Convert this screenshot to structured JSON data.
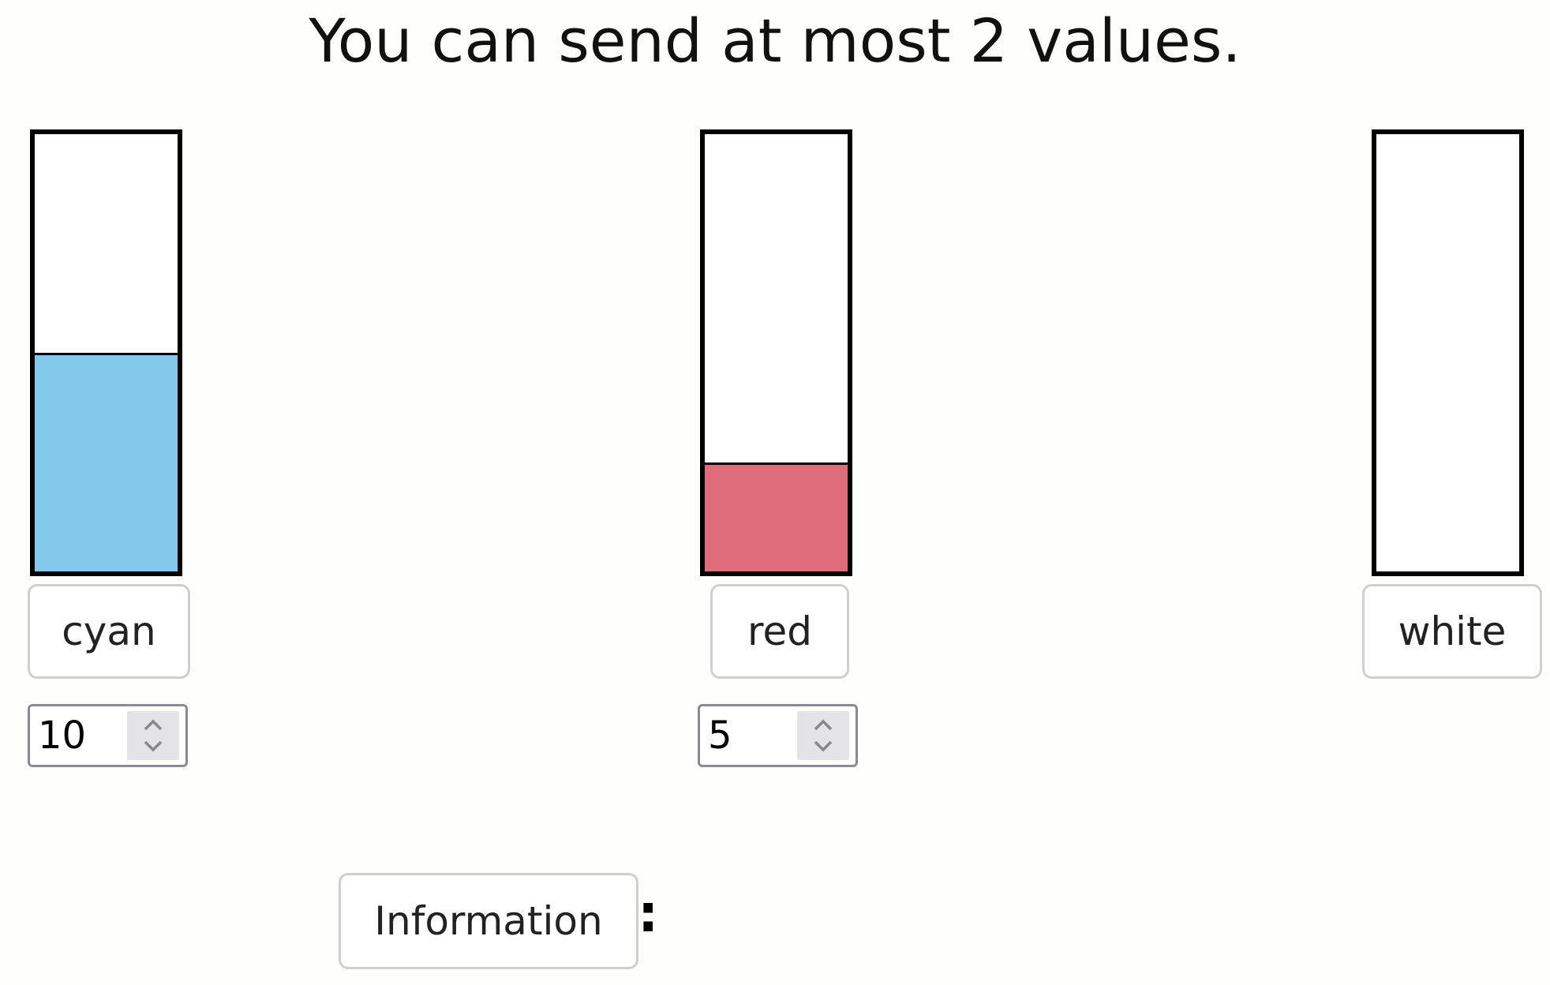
{
  "header": {
    "title": "You can send at most 2 values."
  },
  "bars": [
    {
      "label": "cyan",
      "value": "10",
      "fill_fraction": 0.5,
      "fill_color": "#82c9eb",
      "has_stepper": true
    },
    {
      "label": "red",
      "value": "5",
      "fill_fraction": 0.25,
      "fill_color": "#df6d79",
      "has_stepper": true
    },
    {
      "label": "white",
      "value": null,
      "fill_fraction": 0,
      "fill_color": "#ffffff",
      "has_stepper": false
    }
  ],
  "footer": {
    "info_label": "Information",
    "separator": ":"
  }
}
